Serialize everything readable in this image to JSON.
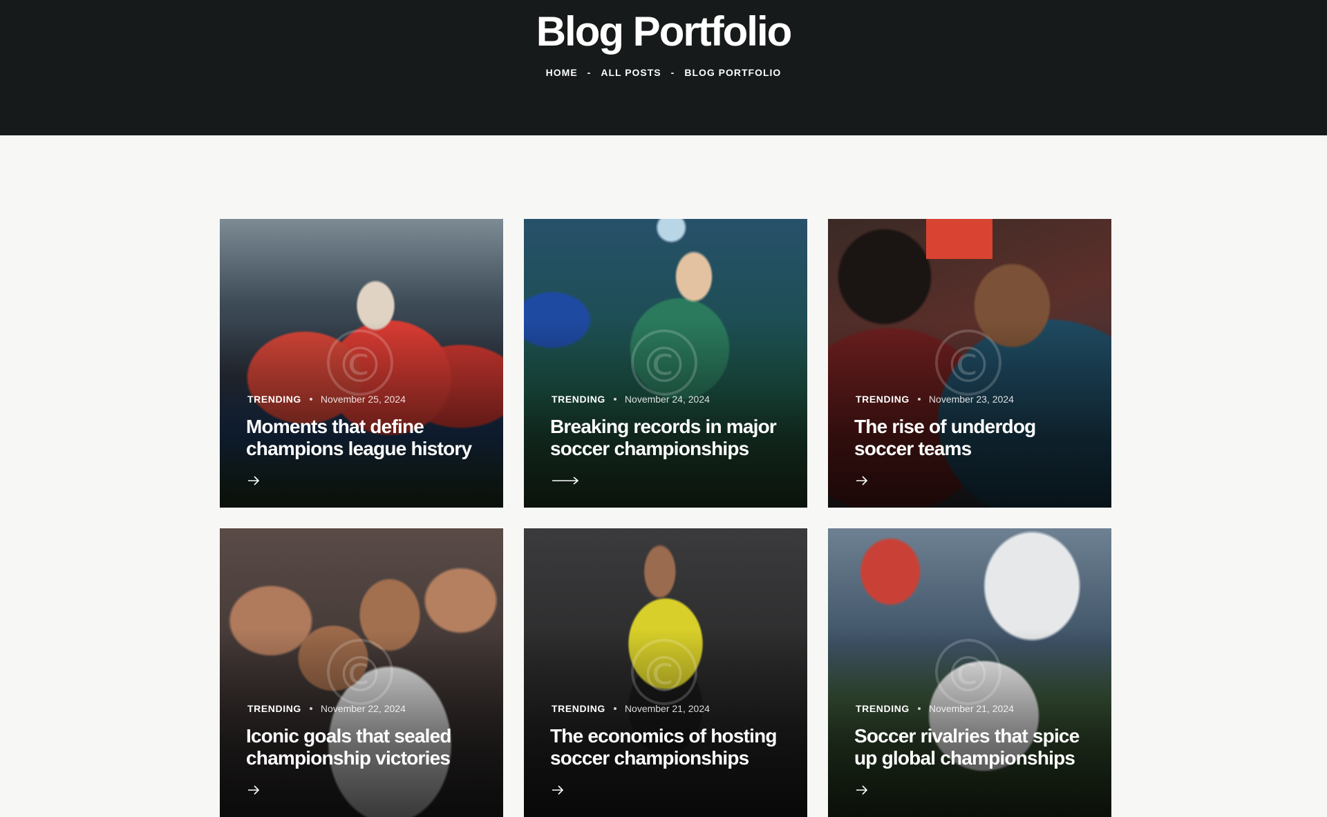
{
  "hero": {
    "title": "Blog Portfolio",
    "breadcrumb": [
      "HOME",
      "ALL POSTS",
      "BLOG PORTFOLIO"
    ],
    "separator": "-"
  },
  "posts": [
    {
      "category": "TRENDING",
      "date": "November 25, 2024",
      "title": "Moments that define champions league history",
      "arrow": "arrow-right-icon"
    },
    {
      "category": "TRENDING",
      "date": "November 24, 2024",
      "title": "Breaking records in major soccer championships",
      "arrow": "arrow-right-long-icon"
    },
    {
      "category": "TRENDING",
      "date": "November 23, 2024",
      "title": "The rise of underdog soccer teams",
      "arrow": "arrow-right-icon"
    },
    {
      "category": "TRENDING",
      "date": "November 22, 2024",
      "title": "Iconic goals that sealed championship victories",
      "arrow": "arrow-right-icon"
    },
    {
      "category": "TRENDING",
      "date": "November 21, 2024",
      "title": "The economics of hosting soccer championships",
      "arrow": "arrow-right-icon"
    },
    {
      "category": "TRENDING",
      "date": "November 21, 2024",
      "title": "Soccer rivalries that spice up global championships",
      "arrow": "arrow-right-icon"
    }
  ],
  "watermark_glyph": "©",
  "colors": {
    "header_bg": "#171a1a",
    "page_bg": "#f7f7f6",
    "text_light": "#ffffff"
  }
}
